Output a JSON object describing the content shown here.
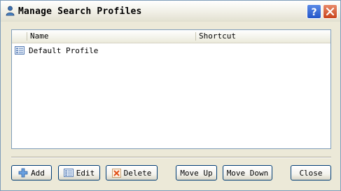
{
  "window": {
    "title": "Manage Search Profiles"
  },
  "icons": {
    "app": "person-icon",
    "help": "help-icon",
    "close": "close-icon",
    "profile": "profile-list-icon",
    "add": "plus-icon",
    "edit": "list-edit-icon",
    "delete": "delete-x-icon"
  },
  "list": {
    "columns": [
      "Name",
      "Shortcut"
    ],
    "rows": [
      {
        "name": "Default Profile",
        "shortcut": ""
      }
    ]
  },
  "buttons": {
    "add": "Add",
    "edit": "Edit",
    "delete": "Delete",
    "move_up": "Move Up",
    "move_down": "Move Down",
    "close": "Close"
  },
  "colors": {
    "help_button": "#2456c9",
    "close_button": "#c9431c",
    "border": "#7f9db9"
  }
}
